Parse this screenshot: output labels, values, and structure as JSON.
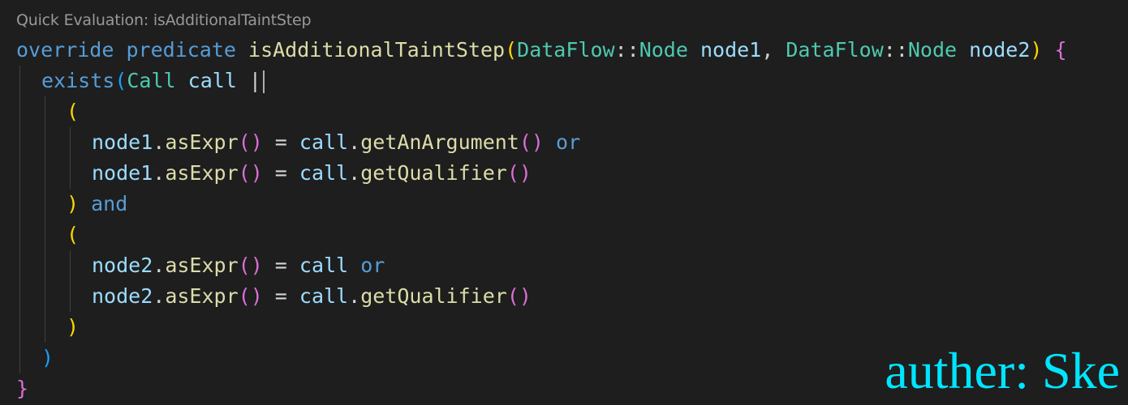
{
  "codelens": "Quick Evaluation: isAdditionalTaintStep",
  "colors": {
    "background": "#1e1e1e",
    "keyword": "#569cd6",
    "function": "#dcdcaa",
    "type": "#4ec9b0",
    "variable": "#9cdcfe",
    "bracket_level1": "#ffd700",
    "bracket_level2": "#da70d6",
    "bracket_level3": "#179fff",
    "watermark": "#00e5ff"
  },
  "lines": [
    {
      "indent": 0,
      "tokens": [
        {
          "t": "override",
          "c": "kw"
        },
        {
          "t": " ",
          "c": "pn"
        },
        {
          "t": "predicate",
          "c": "kw"
        },
        {
          "t": " ",
          "c": "pn"
        },
        {
          "t": "isAdditionalTaintStep",
          "c": "fn"
        },
        {
          "t": "(",
          "c": "b1"
        },
        {
          "t": "DataFlow",
          "c": "ty"
        },
        {
          "t": "::",
          "c": "pn"
        },
        {
          "t": "Node",
          "c": "ty"
        },
        {
          "t": " ",
          "c": "pn"
        },
        {
          "t": "node1",
          "c": "vr"
        },
        {
          "t": ", ",
          "c": "pn"
        },
        {
          "t": "DataFlow",
          "c": "ty"
        },
        {
          "t": "::",
          "c": "pn"
        },
        {
          "t": "Node",
          "c": "ty"
        },
        {
          "t": " ",
          "c": "pn"
        },
        {
          "t": "node2",
          "c": "vr"
        },
        {
          "t": ")",
          "c": "b1"
        },
        {
          "t": " ",
          "c": "pn"
        },
        {
          "t": "{",
          "c": "b2"
        }
      ]
    },
    {
      "indent": 1,
      "cursor": true,
      "tokens": [
        {
          "t": "exists",
          "c": "kw"
        },
        {
          "t": "(",
          "c": "b3"
        },
        {
          "t": "Call",
          "c": "ty"
        },
        {
          "t": " ",
          "c": "pn"
        },
        {
          "t": "call",
          "c": "vr"
        },
        {
          "t": " |",
          "c": "pn"
        }
      ]
    },
    {
      "indent": 2,
      "tokens": [
        {
          "t": "(",
          "c": "b1"
        }
      ]
    },
    {
      "indent": 3,
      "tokens": [
        {
          "t": "node1",
          "c": "vr"
        },
        {
          "t": ".",
          "c": "pn"
        },
        {
          "t": "asExpr",
          "c": "fn"
        },
        {
          "t": "()",
          "c": "b2"
        },
        {
          "t": " = ",
          "c": "pn"
        },
        {
          "t": "call",
          "c": "vr"
        },
        {
          "t": ".",
          "c": "pn"
        },
        {
          "t": "getAnArgument",
          "c": "fn"
        },
        {
          "t": "()",
          "c": "b2"
        },
        {
          "t": " ",
          "c": "pn"
        },
        {
          "t": "or",
          "c": "kw"
        }
      ]
    },
    {
      "indent": 3,
      "tokens": [
        {
          "t": "node1",
          "c": "vr"
        },
        {
          "t": ".",
          "c": "pn"
        },
        {
          "t": "asExpr",
          "c": "fn"
        },
        {
          "t": "()",
          "c": "b2"
        },
        {
          "t": " = ",
          "c": "pn"
        },
        {
          "t": "call",
          "c": "vr"
        },
        {
          "t": ".",
          "c": "pn"
        },
        {
          "t": "getQualifier",
          "c": "fn"
        },
        {
          "t": "()",
          "c": "b2"
        }
      ]
    },
    {
      "indent": 2,
      "tokens": [
        {
          "t": ")",
          "c": "b1"
        },
        {
          "t": " ",
          "c": "pn"
        },
        {
          "t": "and",
          "c": "kw"
        }
      ]
    },
    {
      "indent": 2,
      "tokens": [
        {
          "t": "(",
          "c": "b1"
        }
      ]
    },
    {
      "indent": 3,
      "tokens": [
        {
          "t": "node2",
          "c": "vr"
        },
        {
          "t": ".",
          "c": "pn"
        },
        {
          "t": "asExpr",
          "c": "fn"
        },
        {
          "t": "()",
          "c": "b2"
        },
        {
          "t": " = ",
          "c": "pn"
        },
        {
          "t": "call",
          "c": "vr"
        },
        {
          "t": " ",
          "c": "pn"
        },
        {
          "t": "or",
          "c": "kw"
        }
      ]
    },
    {
      "indent": 3,
      "tokens": [
        {
          "t": "node2",
          "c": "vr"
        },
        {
          "t": ".",
          "c": "pn"
        },
        {
          "t": "asExpr",
          "c": "fn"
        },
        {
          "t": "()",
          "c": "b2"
        },
        {
          "t": " = ",
          "c": "pn"
        },
        {
          "t": "call",
          "c": "vr"
        },
        {
          "t": ".",
          "c": "pn"
        },
        {
          "t": "getQualifier",
          "c": "fn"
        },
        {
          "t": "()",
          "c": "b2"
        }
      ]
    },
    {
      "indent": 2,
      "tokens": [
        {
          "t": ")",
          "c": "b1"
        }
      ]
    },
    {
      "indent": 1,
      "tokens": [
        {
          "t": ")",
          "c": "b3"
        }
      ]
    },
    {
      "indent": 0,
      "tokens": [
        {
          "t": "}",
          "c": "b2"
        }
      ]
    }
  ],
  "watermark": "auther: Ske"
}
